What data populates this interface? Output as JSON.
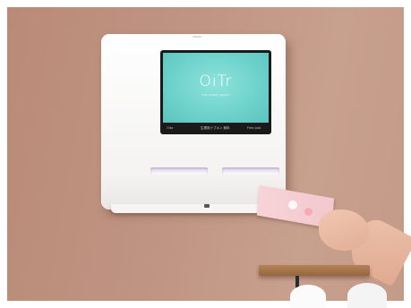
{
  "screen": {
    "logo": "OiTr",
    "tagline": "Free Sanitary Napkin",
    "status_left": "Oita",
    "status_center": "生理用ナプキン 無料",
    "status_right": "Free pad"
  },
  "colors": {
    "wall": "#c09584",
    "screen": "#6fd3cc",
    "dispenser": "#f4f3f2",
    "napkin": "#f3c7cd"
  }
}
